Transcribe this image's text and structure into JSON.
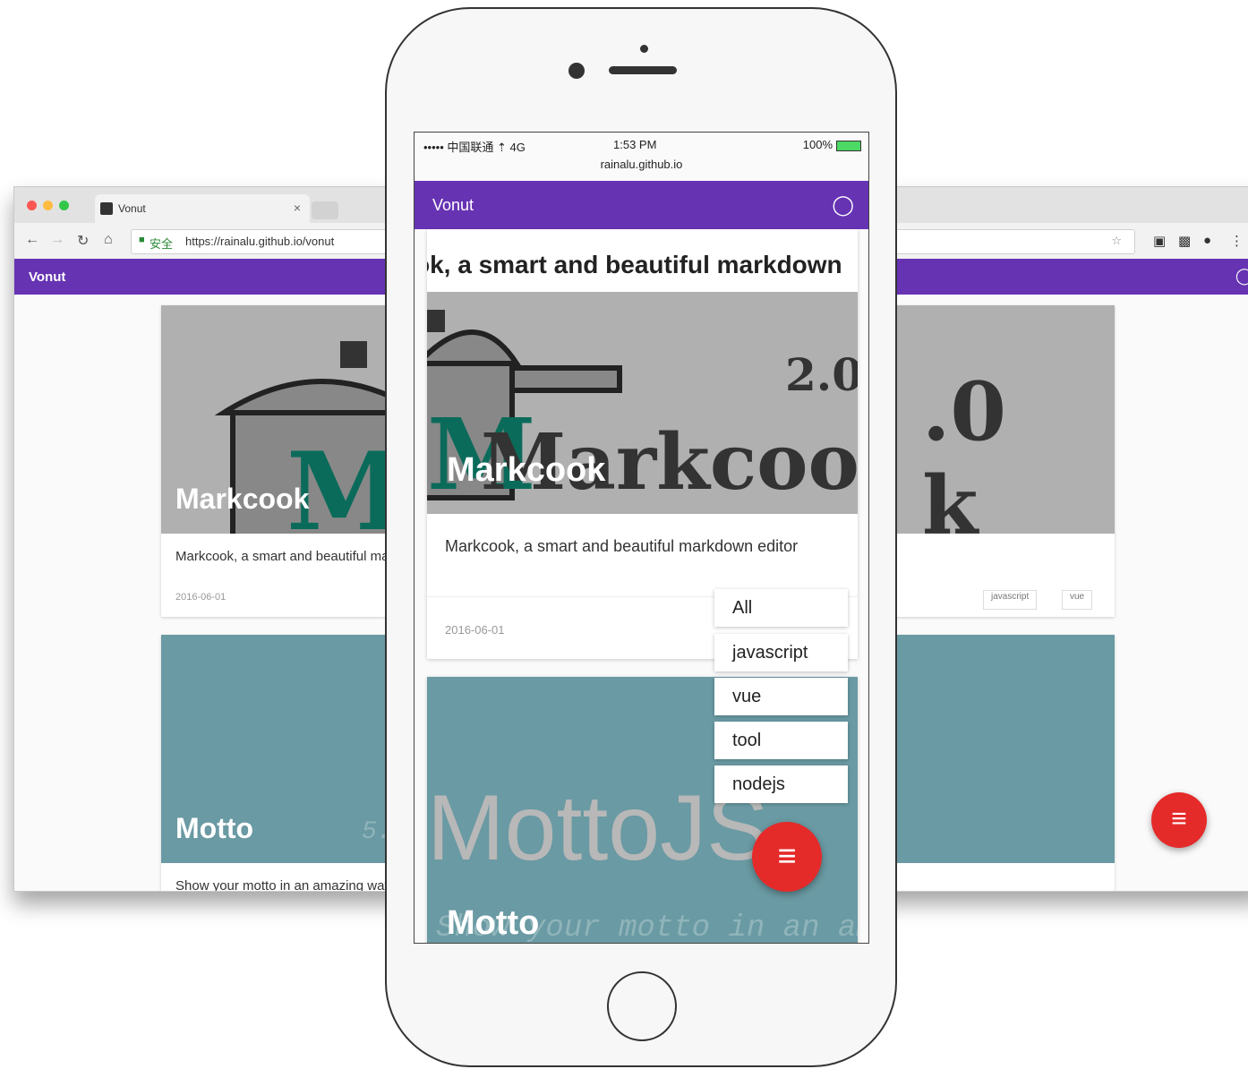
{
  "desktop": {
    "tab_title": "Vonut",
    "tab_close": "×",
    "secure_label": "安全",
    "url": "https://rainalu.github.io/vonut",
    "app_name": "Vonut",
    "github_icon": "github-icon",
    "cards": [
      {
        "title": "Markcook",
        "description": "Markcook, a smart and beautiful markdown editor",
        "date": "2016-06-01",
        "tags": [
          "javascript",
          "vue"
        ],
        "color": "#b0b0b0"
      },
      {
        "title": "Motto",
        "description": "Show your motto in an amazing way",
        "color": "#6a9aa3"
      }
    ],
    "fab_icon": "menu-icon",
    "fab_color": "#e52a2a"
  },
  "phone": {
    "status_carrier": "••••• 中国联通 ⇡ 4G",
    "status_time": "1:53 PM",
    "status_battery": "100%",
    "url": "rainalu.github.io",
    "app_name": "Vonut",
    "cards": [
      {
        "banner_text": "ok, a smart and beautiful markdown",
        "title": "Markcook",
        "logo_text": "Markcook",
        "version": "2.0",
        "description": "Markcook, a smart and beautiful markdown editor",
        "date": "2016-06-01"
      },
      {
        "title": "Motto",
        "logo_text": "MottoJS",
        "tagline": "Show your motto in an amazing"
      }
    ],
    "menu_items": [
      "All",
      "javascript",
      "vue",
      "tool",
      "nodejs"
    ],
    "fab_icon": "menu-icon"
  },
  "colors": {
    "brand": "#6633b3",
    "fab": "#e52a2a",
    "motto_bg": "#6a9aa3"
  }
}
